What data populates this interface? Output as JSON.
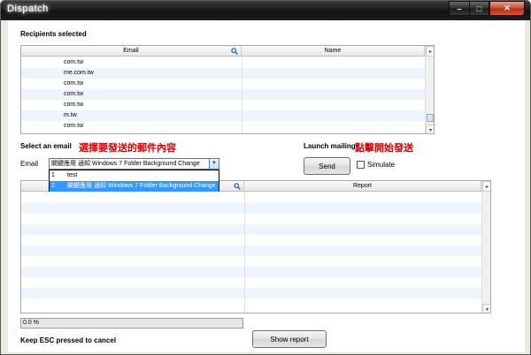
{
  "window": {
    "title": "Dispatch",
    "controls": {
      "minimize": "–",
      "maximize": "□",
      "close": "✕"
    }
  },
  "recipients": {
    "section_title": "Recipients selected",
    "columns": [
      "Email",
      "Name"
    ],
    "rows": [
      {
        "email": "com.tw",
        "name": ""
      },
      {
        "email": "me.com.tw",
        "name": ""
      },
      {
        "email": "com.tw",
        "name": ""
      },
      {
        "email": "com.tw",
        "name": ""
      },
      {
        "email": "com.tw",
        "name": ""
      },
      {
        "email": "m.tw",
        "name": ""
      },
      {
        "email": "com.tw",
        "name": ""
      }
    ]
  },
  "select_email": {
    "section_title": "Select an email",
    "annotation": "選擇要發送的郵件內容",
    "field_label": "Email",
    "selected_value": "關鍵應用 通知 Windows 7 Folder Background Change",
    "options": [
      {
        "num": "1",
        "label": "test"
      },
      {
        "num": "2",
        "label": "關鍵應用 通知 Windows 7 Folder Background Change"
      }
    ]
  },
  "launch": {
    "section_title": "Launch mailing",
    "annotation": "點擊開始發送",
    "send_label": "Send",
    "simulate_label": "Simulate"
  },
  "report": {
    "columns": [
      "",
      "Report"
    ]
  },
  "progress": {
    "text": "0.0 %",
    "value": 0
  },
  "footer": {
    "cancel_hint": "Keep ESC pressed to cancel",
    "show_report_label": "Show report"
  },
  "colors": {
    "titlebar": "#1c1c1c",
    "alt_row": "#eef4fb",
    "selection": "#3399ff",
    "annotation": "#e00000"
  }
}
